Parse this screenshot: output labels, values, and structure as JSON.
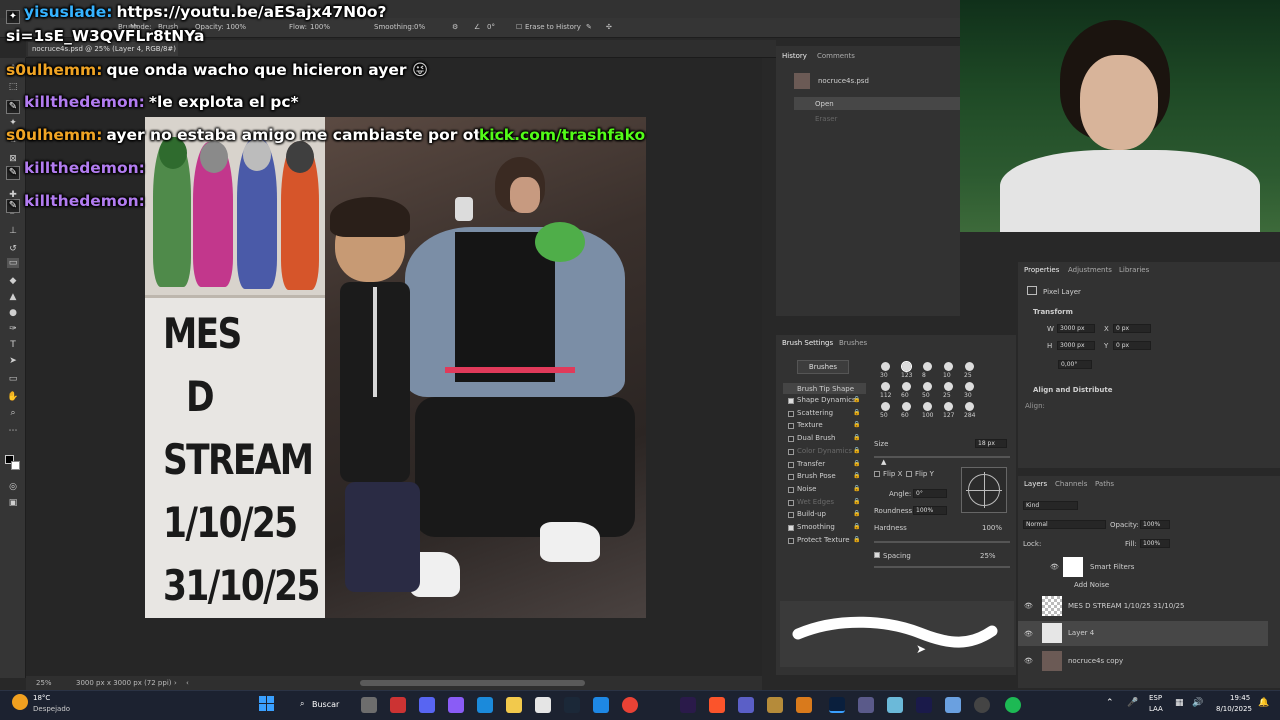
{
  "options_bar": {
    "brush_label": "Brush:",
    "mode_label": "Mode:",
    "mode_value": "Brush",
    "opacity_label": "Opacity:",
    "opacity_value": "100%",
    "flow_label": "Flow:",
    "flow_value": "100%",
    "smoothing_label": "Smoothing:",
    "smoothing_value": "0%",
    "angle_value": "0°",
    "erase_to_history": "Erase to History"
  },
  "document": {
    "tab_title": "nocruce4s.psd @ 25% (Layer 4, RGB/8#)",
    "zoom": "25%",
    "size_info": "3000 px x 3000 px (72 ppi)"
  },
  "poster": {
    "lines": [
      "MES",
      "D",
      "STREAM",
      "1/10/25",
      "31/10/25"
    ]
  },
  "overlay": {
    "url_user": "yisuslade:",
    "url_text": "https://youtu.be/aESajx47N0o?",
    "url_text2": "si=1sE_W3QVFLr8tNYa",
    "kick_text": "kick.com/trashfako"
  },
  "chat": [
    {
      "user": "s0ulhemm:",
      "msg": "que onda wacho que hicieron ayer",
      "color": "orange"
    },
    {
      "user": "killthedemon:",
      "msg": "*le explota el pc*",
      "color": "purple"
    },
    {
      "user": "s0ulhemm:",
      "msg": "ayer no estaba amigo me cambiaste por otro...",
      "color": "orange"
    },
    {
      "user": "killthedemon:",
      "msg": "",
      "color": "purple"
    },
    {
      "user": "killthedemon:",
      "msg": "",
      "color": "purple"
    }
  ],
  "history": {
    "tabs": [
      "History",
      "Comments"
    ],
    "snapshot": "nocruce4s.psd",
    "items": [
      "Open",
      "Eraser"
    ]
  },
  "properties": {
    "tabs": [
      "Properties",
      "Adjustments",
      "Libraries"
    ],
    "layer_type": "Pixel Layer",
    "transform_label": "Transform",
    "w_label": "W",
    "w_value": "3000 px",
    "h_label": "H",
    "h_value": "3000 px",
    "x_label": "X",
    "x_value": "0 px",
    "y_label": "Y",
    "y_value": "0 px",
    "angle_value": "0,00°",
    "align_label": "Align and Distribute",
    "align_sub": "Align:"
  },
  "brush_settings": {
    "tabs": [
      "Brush Settings",
      "Brushes"
    ],
    "brushes_button": "Brushes",
    "tip_shape": "Brush Tip Shape",
    "options": [
      {
        "label": "Shape Dynamics",
        "checked": true
      },
      {
        "label": "Scattering",
        "checked": false
      },
      {
        "label": "Texture",
        "checked": false
      },
      {
        "label": "Dual Brush",
        "checked": false
      },
      {
        "label": "Color Dynamics",
        "checked": false
      },
      {
        "label": "Transfer",
        "checked": false
      },
      {
        "label": "Brush Pose",
        "checked": false
      },
      {
        "label": "Noise",
        "checked": false
      },
      {
        "label": "Wet Edges",
        "checked": false
      },
      {
        "label": "Build-up",
        "checked": false
      },
      {
        "label": "Smoothing",
        "checked": true
      },
      {
        "label": "Protect Texture",
        "checked": false
      }
    ],
    "tip_sizes": [
      "30",
      "123",
      "8",
      "10",
      "25",
      "112",
      "60",
      "50",
      "25",
      "30",
      "50",
      "60",
      "100",
      "127",
      "284"
    ],
    "size_label": "Size",
    "size_value": "18 px",
    "flip_x": "Flip X",
    "flip_y": "Flip Y",
    "angle_label": "Angle:",
    "angle_value": "0°",
    "roundness_label": "Roundness:",
    "roundness_value": "100%",
    "hardness_label": "Hardness",
    "hardness_value": "100%",
    "spacing_label": "Spacing",
    "spacing_value": "25%"
  },
  "layers": {
    "tabs": [
      "Layers",
      "Channels",
      "Paths"
    ],
    "filter_kind": "Kind",
    "blend_mode": "Normal",
    "opacity_label": "Opacity:",
    "opacity_value": "100%",
    "lock_label": "Lock:",
    "fill_label": "Fill:",
    "fill_value": "100%",
    "items": [
      {
        "name": "Smart Filters"
      },
      {
        "name": "Add Noise"
      },
      {
        "name": "MES   D  STREAM 1/10/25 31/10/25"
      },
      {
        "name": "Layer 4"
      },
      {
        "name": "nocruce4s copy"
      }
    ]
  },
  "taskbar": {
    "weather_temp": "18°C",
    "weather_desc": "Despejado",
    "search_label": "Buscar",
    "lang_top": "ESP",
    "lang_bottom": "LAA",
    "time": "19:45",
    "date": "8/10/2025"
  },
  "colors": {
    "ps_panel": "#323232",
    "chat_orange": "#f0a424",
    "chat_purple": "#b27cf0",
    "kick_green": "#53fc18",
    "webcam_green": "#2c5a30"
  }
}
